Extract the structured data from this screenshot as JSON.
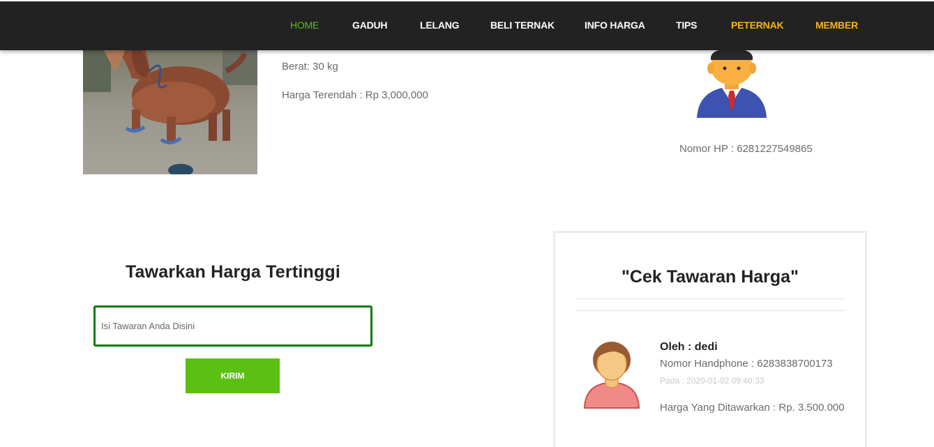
{
  "nav": {
    "items": [
      {
        "label": "HOME",
        "state": "active"
      },
      {
        "label": "GADUH",
        "state": "normal"
      },
      {
        "label": "LELANG",
        "state": "normal"
      },
      {
        "label": "BELI TERNAK",
        "state": "normal"
      },
      {
        "label": "INFO HARGA",
        "state": "normal"
      },
      {
        "label": "TIPS",
        "state": "normal"
      },
      {
        "label": "PETERNAK",
        "state": "highlight"
      },
      {
        "label": "MEMBER",
        "state": "highlight"
      }
    ]
  },
  "product": {
    "weight": "Berat: 30 kg",
    "lowest_price": "Harga Terendah : Rp 3,000,000"
  },
  "owner": {
    "phone": "Nomor HP : 6281227549865"
  },
  "offer_form": {
    "title": "Tawarkan Harga Tertinggi",
    "placeholder": "Isi Tawaran Anda Disini",
    "submit_label": "KIRIM"
  },
  "bids": {
    "title": "\"Cek Tawaran Harga\"",
    "items": [
      {
        "by": "Oleh : dedi",
        "phone": "Nomor Handphone : 6283838700173",
        "date": "Pada : 2020-01-02 09:40:33",
        "price": "Harga Yang Ditawarkan : Rp. 3.500.000"
      }
    ]
  },
  "colors": {
    "nav_bg": "#222222",
    "active": "#5cbf14",
    "highlight": "#f5b70f",
    "input_border": "#0e7a0e"
  }
}
